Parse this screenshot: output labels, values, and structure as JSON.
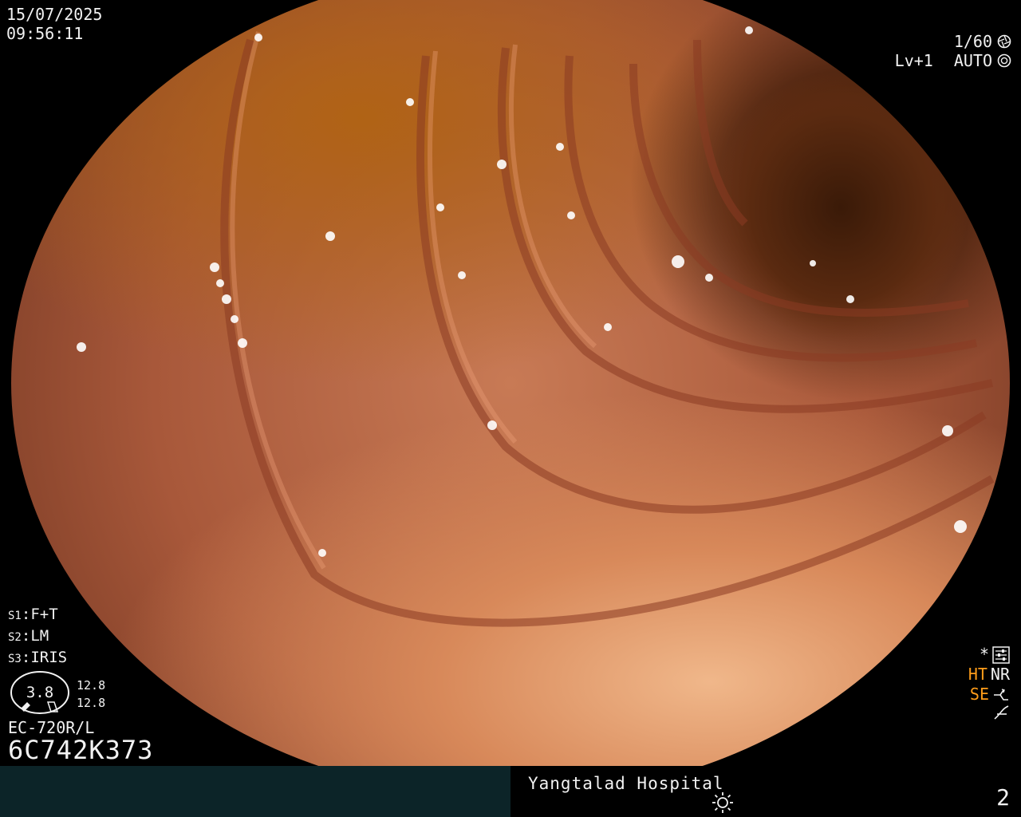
{
  "header": {
    "date": "15/07/2025",
    "time": "09:56:11"
  },
  "shutter": {
    "speed": "1/60",
    "level": "Lv+1",
    "mode": "AUTO"
  },
  "modes": [
    {
      "key": "S1",
      "value": "F+T"
    },
    {
      "key": "S2",
      "value": "LM"
    },
    {
      "key": "S3",
      "value": "IRIS"
    }
  ],
  "gauge": {
    "value": "3.8",
    "upper": "12.8",
    "lower": "12.8"
  },
  "scope": {
    "model": "EC-720R/L",
    "serial": "6C742K373"
  },
  "status": {
    "star": "*",
    "ht": "HT",
    "nr": "NR",
    "se": "SE"
  },
  "footer": {
    "hospital": "Yangtalad Hospital",
    "page": "2"
  },
  "colors": {
    "amber": "#ff9d1a",
    "panel": "#0c2428",
    "text": "#f2f2f2"
  },
  "icons": [
    "aperture-icon",
    "iris-icon",
    "settings-icon",
    "enhance-icon",
    "freeze-icon",
    "light-source-icon"
  ]
}
